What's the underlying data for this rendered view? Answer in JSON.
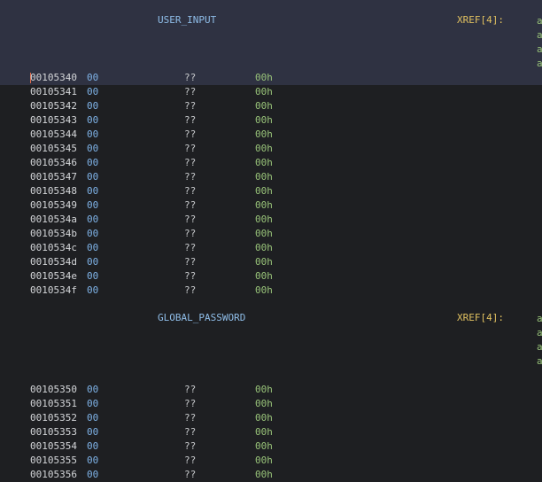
{
  "listing": {
    "blocks": [
      {
        "label": "USER_INPUT",
        "xref_label": "XREF[4]:",
        "xrefs": [
          "a",
          "a",
          "a",
          "a"
        ],
        "rows": [
          {
            "addr": "00105340",
            "byte": "00",
            "mnemonic": "??",
            "operand": "00h"
          },
          {
            "addr": "00105341",
            "byte": "00",
            "mnemonic": "??",
            "operand": "00h"
          },
          {
            "addr": "00105342",
            "byte": "00",
            "mnemonic": "??",
            "operand": "00h"
          },
          {
            "addr": "00105343",
            "byte": "00",
            "mnemonic": "??",
            "operand": "00h"
          },
          {
            "addr": "00105344",
            "byte": "00",
            "mnemonic": "??",
            "operand": "00h"
          },
          {
            "addr": "00105345",
            "byte": "00",
            "mnemonic": "??",
            "operand": "00h"
          },
          {
            "addr": "00105346",
            "byte": "00",
            "mnemonic": "??",
            "operand": "00h"
          },
          {
            "addr": "00105347",
            "byte": "00",
            "mnemonic": "??",
            "operand": "00h"
          },
          {
            "addr": "00105348",
            "byte": "00",
            "mnemonic": "??",
            "operand": "00h"
          },
          {
            "addr": "00105349",
            "byte": "00",
            "mnemonic": "??",
            "operand": "00h"
          },
          {
            "addr": "0010534a",
            "byte": "00",
            "mnemonic": "??",
            "operand": "00h"
          },
          {
            "addr": "0010534b",
            "byte": "00",
            "mnemonic": "??",
            "operand": "00h"
          },
          {
            "addr": "0010534c",
            "byte": "00",
            "mnemonic": "??",
            "operand": "00h"
          },
          {
            "addr": "0010534d",
            "byte": "00",
            "mnemonic": "??",
            "operand": "00h"
          },
          {
            "addr": "0010534e",
            "byte": "00",
            "mnemonic": "??",
            "operand": "00h"
          },
          {
            "addr": "0010534f",
            "byte": "00",
            "mnemonic": "??",
            "operand": "00h"
          }
        ]
      },
      {
        "label": "GLOBAL_PASSWORD",
        "xref_label": "XREF[4]:",
        "xrefs": [
          "a",
          "a",
          "a",
          "a"
        ],
        "rows": [
          {
            "addr": "00105350",
            "byte": "00",
            "mnemonic": "??",
            "operand": "00h"
          },
          {
            "addr": "00105351",
            "byte": "00",
            "mnemonic": "??",
            "operand": "00h"
          },
          {
            "addr": "00105352",
            "byte": "00",
            "mnemonic": "??",
            "operand": "00h"
          },
          {
            "addr": "00105353",
            "byte": "00",
            "mnemonic": "??",
            "operand": "00h"
          },
          {
            "addr": "00105354",
            "byte": "00",
            "mnemonic": "??",
            "operand": "00h"
          },
          {
            "addr": "00105355",
            "byte": "00",
            "mnemonic": "??",
            "operand": "00h"
          },
          {
            "addr": "00105356",
            "byte": "00",
            "mnemonic": "??",
            "operand": "00h"
          }
        ]
      }
    ]
  }
}
